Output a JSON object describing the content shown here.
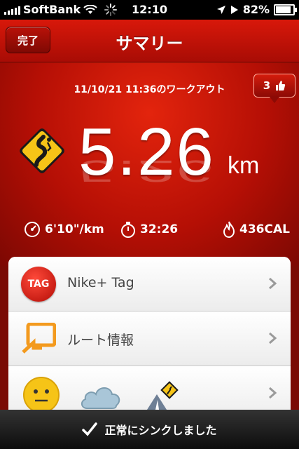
{
  "status_bar": {
    "carrier": "SoftBank",
    "time": "12:10",
    "battery": "82%",
    "battery_level": 0.82,
    "icons": [
      "signal-bars-icon",
      "wifi-icon",
      "activity-spinner-icon",
      "location-arrow-icon",
      "play-icon",
      "battery-icon"
    ]
  },
  "nav": {
    "done_label": "完了",
    "title": "サマリー"
  },
  "workout": {
    "date_label": "11/10/21 11:36のワークアウト",
    "likes_count": "3",
    "distance": "5.26",
    "unit": "km",
    "pace": "6'10\"/km",
    "duration": "32:26",
    "calories": "436CAL"
  },
  "list": {
    "items": [
      {
        "label": "Nike+ Tag",
        "icon": "nike-tag-icon",
        "icon_text": "TAG"
      },
      {
        "label": "ルート情報",
        "icon": "route-info-icon"
      },
      {
        "label": "",
        "icons": [
          "neutral-face-icon",
          "cloud-icon",
          "road-terrain-icon"
        ]
      }
    ]
  },
  "toast": {
    "message": "正常にシンクしました"
  },
  "colors": {
    "brand_red": "#c8150a",
    "dark_red": "#7c0803",
    "panel_bg": "#f2f2f2",
    "sign_yellow": "#f6c417",
    "route_orange": "#f39a1e"
  }
}
